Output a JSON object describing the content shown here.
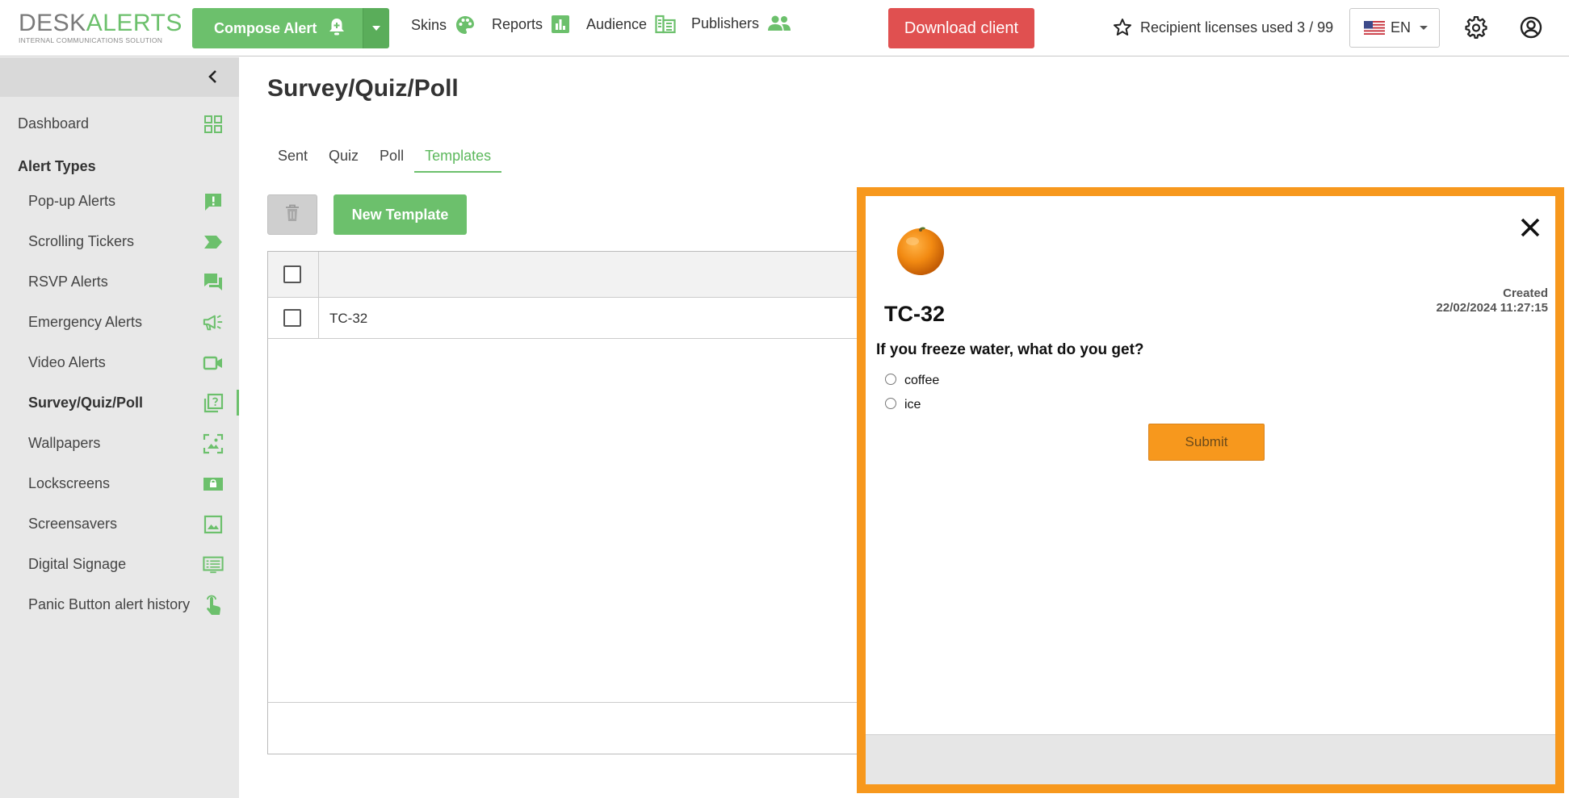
{
  "header": {
    "logo_desk": "DESK",
    "logo_alerts": "ALERTS",
    "logo_tagline": "INTERNAL COMMUNICATIONS SOLUTION",
    "compose_label": "Compose Alert",
    "nav": [
      {
        "label": "Skins",
        "icon": "palette-icon"
      },
      {
        "label": "Reports",
        "icon": "bar-chart-icon"
      },
      {
        "label": "Audience",
        "icon": "audience-icon"
      },
      {
        "label": "Publishers",
        "icon": "people-icon"
      }
    ],
    "download_label": "Download client",
    "licenses_label": "Recipient licenses used 3 / 99",
    "language": "EN",
    "accent": "#6cc06c",
    "download_color": "#e05050"
  },
  "sidebar": {
    "dashboard": "Dashboard",
    "section_title": "Alert Types",
    "items": [
      {
        "label": "Pop-up Alerts",
        "icon": "alert-bubble-icon"
      },
      {
        "label": "Scrolling Tickers",
        "icon": "ticker-icon"
      },
      {
        "label": "RSVP Alerts",
        "icon": "chat-icon"
      },
      {
        "label": "Emergency Alerts",
        "icon": "megaphone-icon"
      },
      {
        "label": "Video Alerts",
        "icon": "video-icon"
      },
      {
        "label": "Survey/Quiz/Poll",
        "icon": "survey-icon",
        "active": true
      },
      {
        "label": "Wallpapers",
        "icon": "wallpaper-icon"
      },
      {
        "label": "Lockscreens",
        "icon": "lock-icon"
      },
      {
        "label": "Screensavers",
        "icon": "image-icon"
      },
      {
        "label": "Digital Signage",
        "icon": "signage-icon"
      },
      {
        "label": "Panic Button alert history",
        "icon": "touch-icon"
      }
    ]
  },
  "main": {
    "title": "Survey/Quiz/Poll",
    "tabs": [
      "Sent",
      "Quiz",
      "Poll",
      "Templates"
    ],
    "active_tab": "Templates",
    "new_template_label": "New Template",
    "rows": [
      {
        "name": "TC-32"
      }
    ]
  },
  "preview": {
    "title": "TC-32",
    "created_label": "Created",
    "created_date": "22/02/2024 11:27:15",
    "question": "If you freeze water, what do you get?",
    "options": [
      "coffee",
      "ice"
    ],
    "submit_label": "Submit",
    "frame_color": "#f7981d"
  }
}
